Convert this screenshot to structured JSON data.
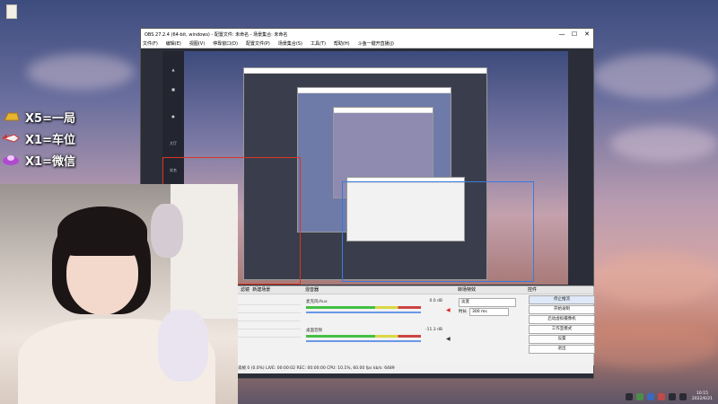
{
  "obs": {
    "title": "OBS 27.2.4 (64-bit, windows) - 配置文件: 未命名 - 场景集合: 未命名",
    "menu": [
      "文件(F)",
      "编辑(E)",
      "视图(V)",
      "停靠窗口(D)",
      "配置文件(P)",
      "场景集合(S)",
      "工具(T)",
      "帮助(H)",
      "斗鱼一键开直播(J)"
    ],
    "window_controls": {
      "minimize": "—",
      "maximize": "☐",
      "close": "✕"
    }
  },
  "overlay": {
    "rows": [
      {
        "icon": "gold-bar-icon",
        "text": "X5=一局"
      },
      {
        "icon": "rocket-icon",
        "text": "X1=车位"
      },
      {
        "icon": "spaceship-icon",
        "text": "X1=微信"
      }
    ]
  },
  "sources": {
    "tabs": [
      "滤镜",
      "截图源",
      "新建场景"
    ],
    "items": [
      "",
      "",
      "",
      "",
      ""
    ]
  },
  "mixer": {
    "title": "混音器",
    "channels": [
      {
        "name": "麦克风/Aux",
        "db": "0.0 dB"
      },
      {
        "name": "桌面音频",
        "db": "-11.3 dB"
      }
    ]
  },
  "transitions": {
    "title": "转场特效",
    "type": "淡变",
    "duration_label": "时长",
    "duration": "300 ms"
  },
  "controls": {
    "title": "控件",
    "buttons": [
      "停止推流",
      "开始录制",
      "启动虚拟摄像机",
      "工作室模式",
      "设置",
      "退出"
    ]
  },
  "status": {
    "text": "丢帧 0 (0.0%)   LIVE: 00:00:02   REC: 00:00:00   CPU: 10.1%, 60.00 fps   kb/s: 6489"
  },
  "sidebar_labels": [
    "",
    "",
    "大厅",
    "实名"
  ],
  "taskbar": {
    "time": "10:15",
    "date": "2022/6/21"
  },
  "colors": {
    "obs_dark": "#2b2e38",
    "selection_red": "#dd3322",
    "selection_blue": "#3a7ae0",
    "live_green": "#43c043"
  }
}
